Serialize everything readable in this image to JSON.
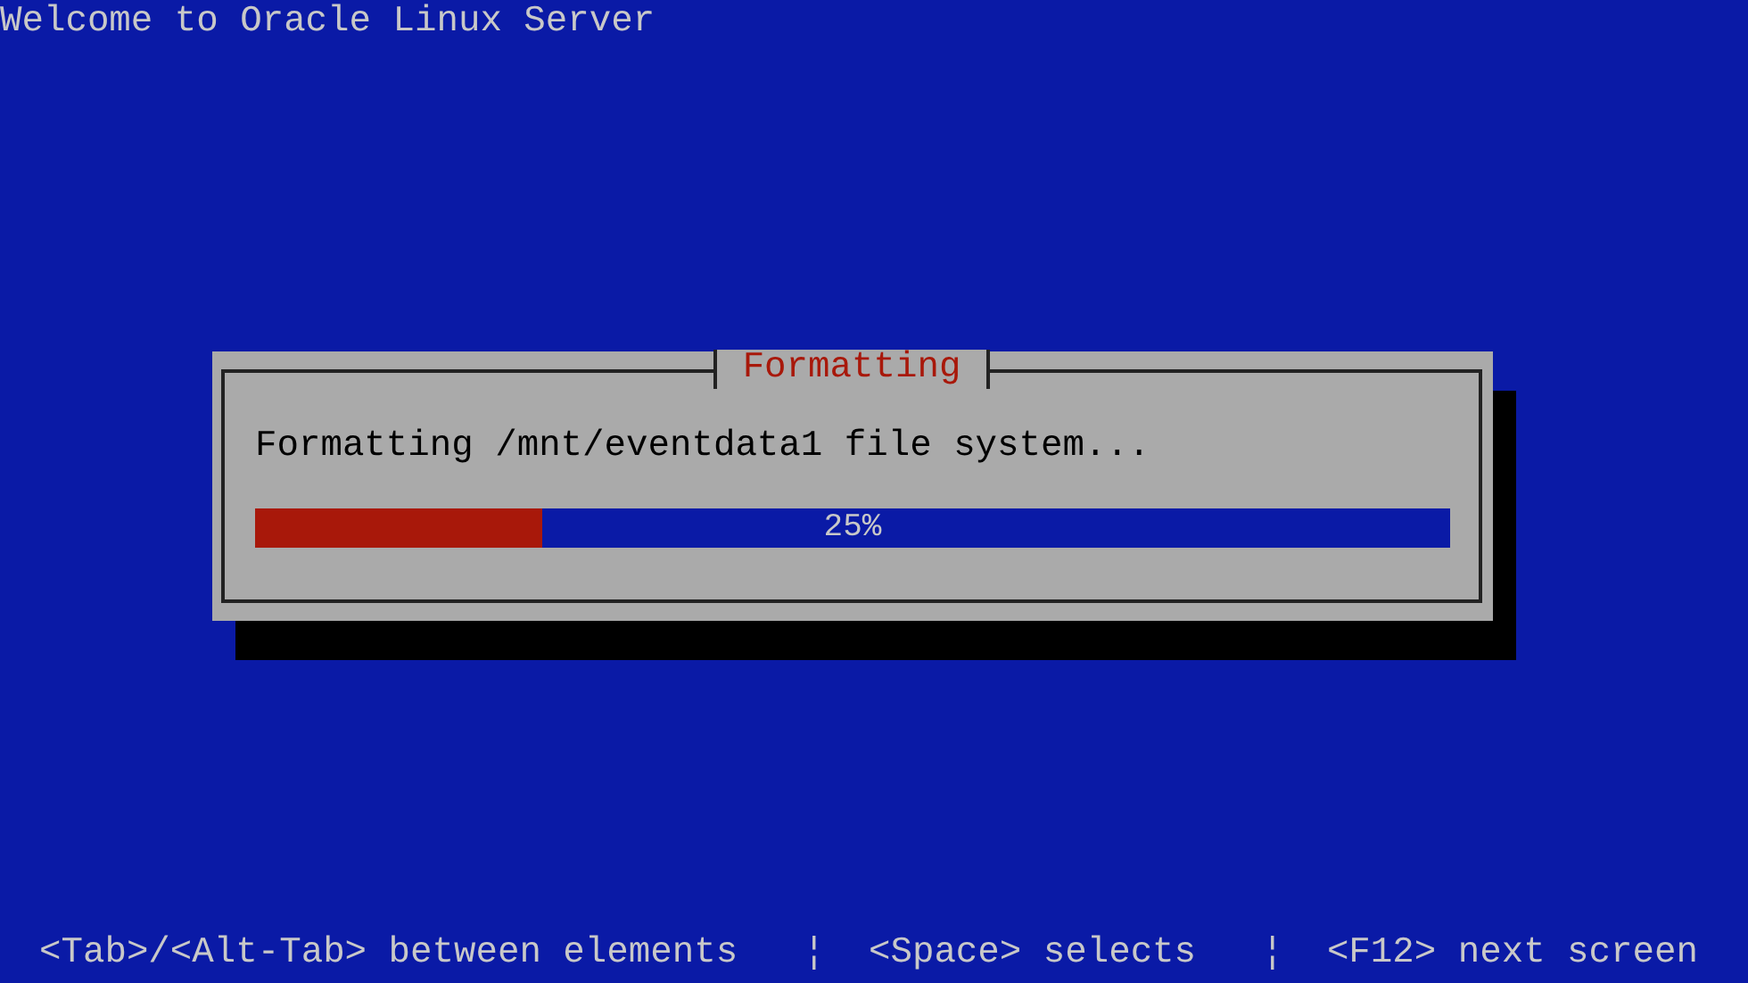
{
  "window": {
    "title": "Welcome to Oracle Linux Server"
  },
  "dialog": {
    "title": "Formatting",
    "message": "Formatting /mnt/eventdata1 file system...",
    "progress": {
      "level": 0.24,
      "reading": "25%"
    }
  },
  "help_line": "<Tab>/<Alt-Tab> between elements   ¦  <Space> selects   ¦  <F12> next screen"
}
